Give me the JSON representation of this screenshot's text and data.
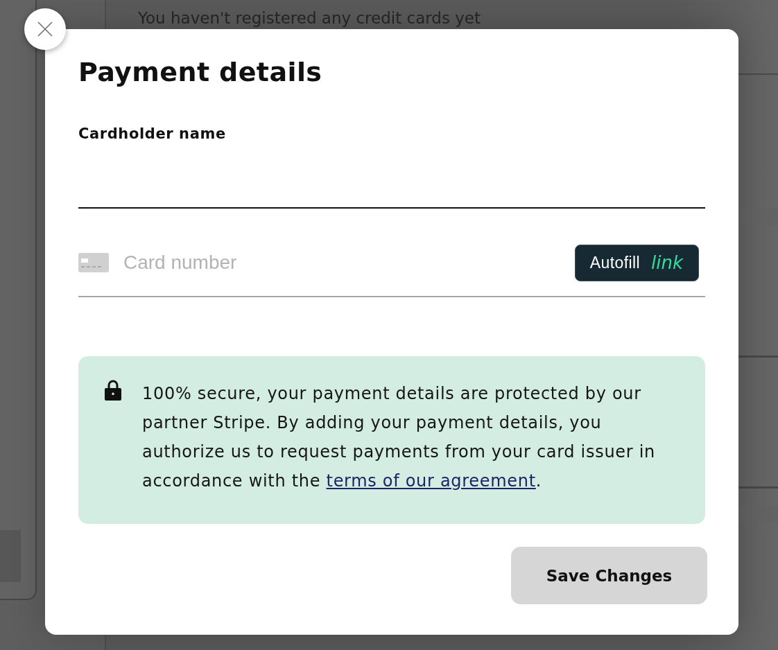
{
  "background": {
    "message": "You haven't registered any credit cards yet"
  },
  "dialog": {
    "title": "Payment details",
    "fields": [
      {
        "kind": "text",
        "label": "Cardholder name"
      },
      {
        "kind": "card",
        "placeholder": "Card number",
        "autofill": {
          "label": "Autofill",
          "brand": "link"
        }
      }
    ],
    "notice": {
      "text": "100% secure, your payment details are protected by our partner Stripe. By adding your payment details, you authorize us to request payments from your card issuer in accordance with the ",
      "link": "terms of our agreement",
      "end": "."
    },
    "buttons": [
      {
        "label": "Save Changes"
      }
    ]
  }
}
